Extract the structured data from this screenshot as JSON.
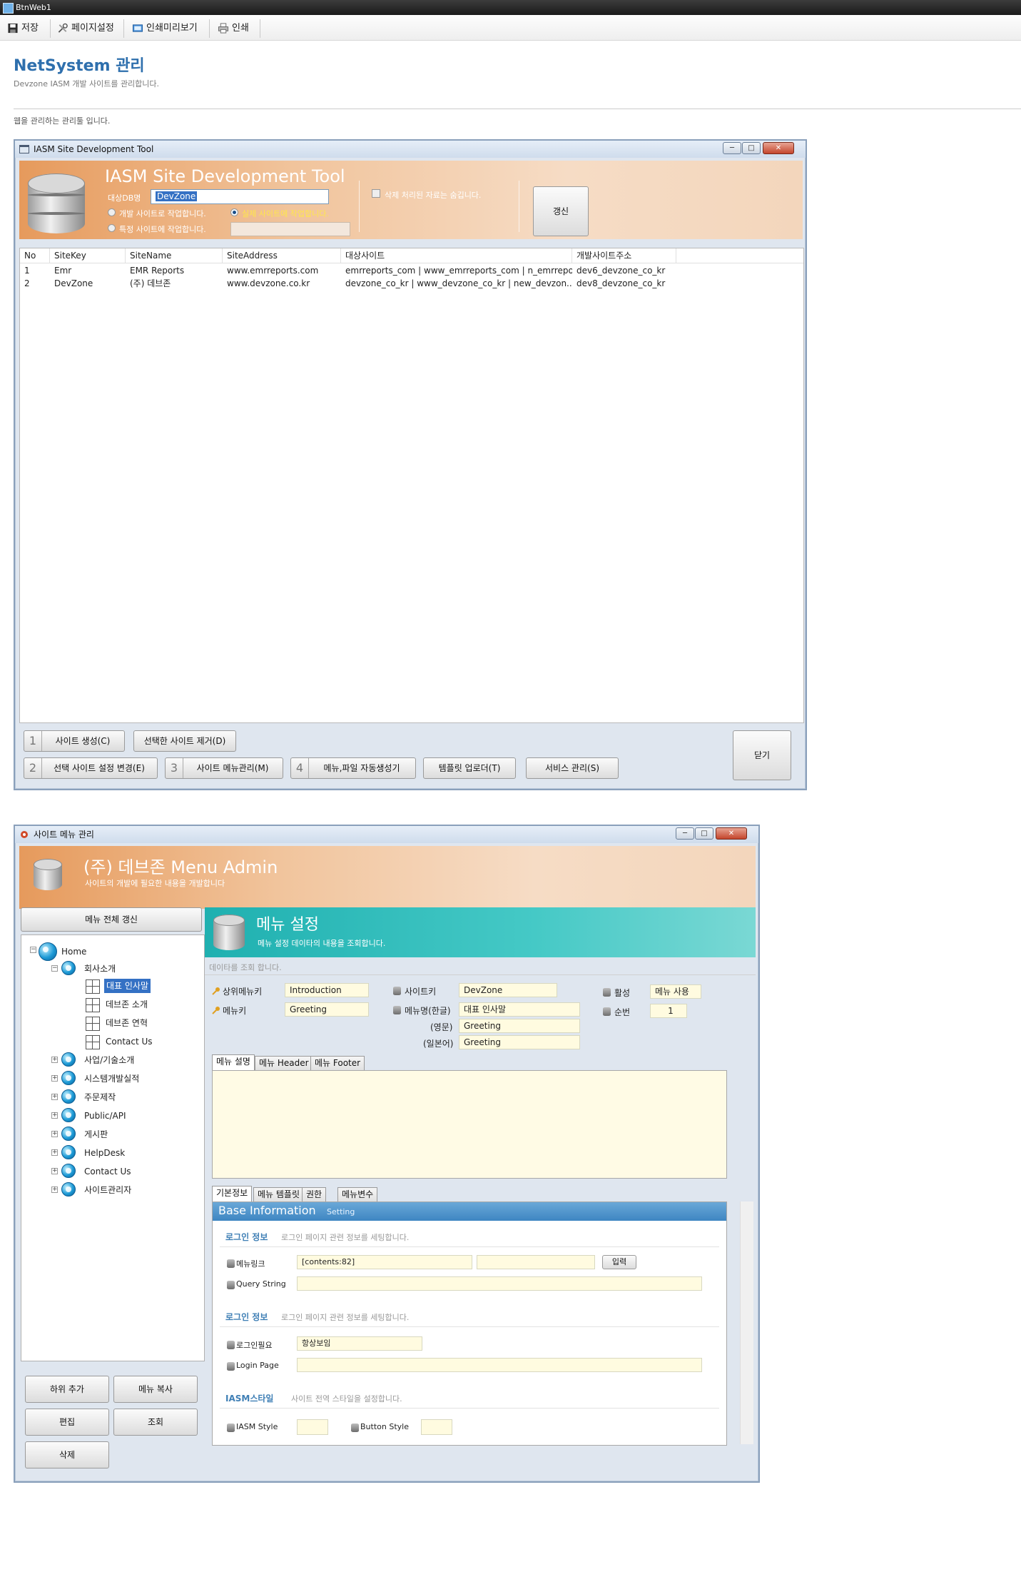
{
  "window_title": "BtnWeb1",
  "toolbar": {
    "save": "저장",
    "page_setup": "페이지설정",
    "print_preview": "인쇄미리보기",
    "print": "인쇄"
  },
  "page": {
    "title": "NetSystem 관리",
    "subtitle": "Devzone IASM 개발 사이트를 관리합니다.",
    "description": "웹을 관리하는 관리툴 입니다."
  },
  "tool": {
    "window_title": "IASM Site Development Tool",
    "header_title": "IASM Site Development Tool",
    "db_label": "대상DB명",
    "db_value": "DevZone",
    "radio_dev": "개발 사이트로 작업합니다.",
    "radio_real": "실제 사이트에 작업합니다.",
    "radio_specific": "특정 사이트에 작업합니다.",
    "include_deleted": "삭제 처리된 자료는 숨깁니다.",
    "refresh_button": "갱신",
    "columns": [
      "No",
      "SiteKey",
      "SiteName",
      "SiteAddress",
      "대상사이트",
      "개발사이트주소"
    ],
    "rows": [
      [
        "1",
        "Emr",
        "EMR Reports",
        "www.emrreports.com",
        "emrreports_com | www_emrreports_com | n_emrrepo...",
        "dev6_devzone_co_kr"
      ],
      [
        "2",
        "DevZone",
        "(주) 데브존",
        "www.devzone.co.kr",
        "devzone_co_kr | www_devzone_co_kr | new_devzon...",
        "dev8_devzone_co_kr"
      ]
    ],
    "buttons": {
      "b1_num": "1",
      "b1": "사이트 생성(C)",
      "remove": "선택한 사이트 제거(D)",
      "b2_num": "2",
      "b2": "선택 사이트 설정 변경(E)",
      "b3_num": "3",
      "b3": "사이트 메뉴관리(M)",
      "b4_num": "4",
      "b4": "메뉴,파일 자동생성기",
      "template_upload": "템플릿 업로더(T)",
      "service": "서비스 관리(S)",
      "close": "닫기"
    }
  },
  "menu_admin": {
    "window_title": "사이트 메뉴 관리",
    "header_title": "(주) 데브존 Menu Admin",
    "header_subtitle": "사이트의 개발에 필요한 내용을 개발합니다",
    "refresh_all": "메뉴 전체 갱신",
    "tree": {
      "root": "Home",
      "company": "회사소개",
      "company_children": [
        "대표 인사말",
        "데브존 소개",
        "데브존 연혁",
        "Contact Us"
      ],
      "others": [
        "사업/기술소개",
        "시스템개발실적",
        "주문제작",
        "Public/API",
        "게시판",
        "HelpDesk",
        "Contact Us",
        "사이트관리자"
      ]
    },
    "left_buttons": {
      "add_child": "하위 추가",
      "copy_menu": "메뉴 복사",
      "edit": "편집",
      "view": "조회",
      "delete": "삭제"
    },
    "settings": {
      "title": "메뉴 설정",
      "subtitle": "메뉴 설정 데이타의 내용을 조회합니다.",
      "status": "데이타를 조회 합니다.",
      "parent_menu_key_label": "상위메뉴키",
      "parent_menu_key": "Introduction",
      "menu_key_label": "메뉴키",
      "menu_key": "Greeting",
      "site_key_label": "사이트키",
      "site_key": "DevZone",
      "menu_name_kr_label": "메뉴명(한글)",
      "menu_name_kr": "대표 인사말",
      "menu_name_en_label": "(영문)",
      "menu_name_en": "Greeting",
      "menu_name_jp_label": "(일본어)",
      "menu_name_jp": "Greeting",
      "active_label": "활성",
      "active": "메뉴 사용",
      "order_label": "순번",
      "order": "1",
      "desc_tabs": [
        "메뉴 설명",
        "메뉴 Header",
        "메뉴 Footer"
      ],
      "info_tabs": [
        "기본정보",
        "메뉴 템플릿",
        "권한",
        "메뉴변수"
      ]
    },
    "base_info": {
      "title": "Base Information",
      "setting": "Setting",
      "login_section": "로그인 정보",
      "login_section_desc": "로그인 페이지 관련 정보를 세팅합니다.",
      "menu_link_label": "메뉴링크",
      "menu_link": "[contents:82]",
      "menu_link_2": "",
      "input_button": "입력",
      "query_string_label": "Query String",
      "query_string": "",
      "login_section2": "로그인 정보",
      "login_section2_desc": "로그인 페이지 관련 정보를 세팅합니다.",
      "login_required_label": "로그인필요",
      "login_required": "항상보임",
      "login_page_label": "Login Page",
      "login_page": "",
      "style_section": "IASM스타일",
      "style_section_desc": "사이트 전역 스타일을 설정합니다.",
      "iasm_style_label": "IASM Style",
      "iasm_style": "",
      "button_style_label": "Button Style",
      "button_style": ""
    }
  }
}
